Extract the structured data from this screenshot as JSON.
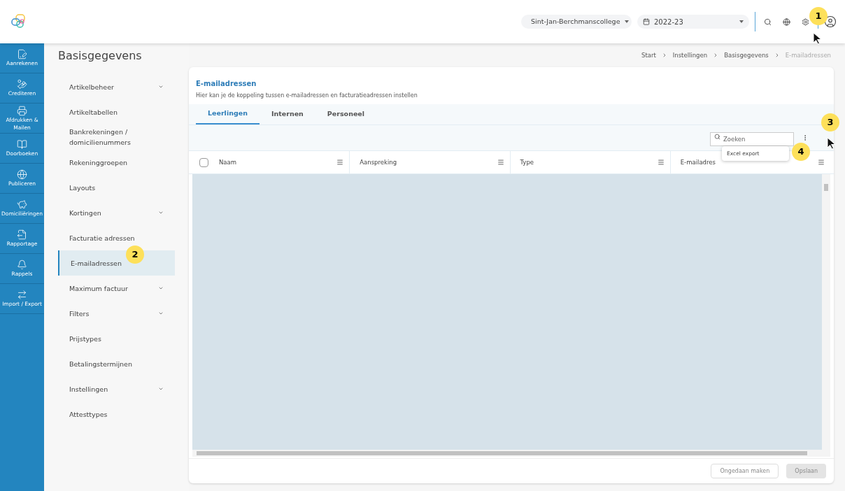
{
  "header": {
    "school": "Sint-Jan-Berchmanscollege",
    "year": "2022-23"
  },
  "rail": [
    {
      "label": "Aanrekenen"
    },
    {
      "label": "Crediteren"
    },
    {
      "label": "Afdrukken & Mailen"
    },
    {
      "label": "Doorboeken"
    },
    {
      "label": "Publiceren"
    },
    {
      "label": "Domiciliëringen"
    },
    {
      "label": "Rapportage"
    },
    {
      "label": "Rappels"
    },
    {
      "label": "Import / Export"
    }
  ],
  "page_title": "Basisgegevens",
  "breadcrumb": [
    "Start",
    "Instellingen",
    "Basisgegevens",
    "E-mailadressen"
  ],
  "menu": [
    {
      "label": "Artikelbeheer",
      "expandable": true,
      "selected": false
    },
    {
      "label": "Artikeltabellen",
      "expandable": false,
      "selected": false
    },
    {
      "label": "Bankrekeningen / domicilienummers",
      "expandable": false,
      "selected": false
    },
    {
      "label": "Rekeninggroepen",
      "expandable": false,
      "selected": false
    },
    {
      "label": "Layouts",
      "expandable": false,
      "selected": false
    },
    {
      "label": "Kortingen",
      "expandable": true,
      "selected": false
    },
    {
      "label": "Facturatie adressen",
      "expandable": false,
      "selected": false
    },
    {
      "label": "E-mailadressen",
      "expandable": false,
      "selected": true
    },
    {
      "label": "Maximum factuur",
      "expandable": true,
      "selected": false
    },
    {
      "label": "Filters",
      "expandable": true,
      "selected": false
    },
    {
      "label": "Prijstypes",
      "expandable": false,
      "selected": false
    },
    {
      "label": "Betalingstermijnen",
      "expandable": false,
      "selected": false
    },
    {
      "label": "Instellingen",
      "expandable": true,
      "selected": false
    },
    {
      "label": "Attesttypes",
      "expandable": false,
      "selected": false
    }
  ],
  "card": {
    "title": "E-mailadressen",
    "description": "Hier kan je de koppeling tussen e-mailadressen en facturatieadressen instellen",
    "tabs": [
      {
        "label": "Leerlingen",
        "selected": true
      },
      {
        "label": "Internen",
        "selected": false
      },
      {
        "label": "Personeel",
        "selected": false
      }
    ],
    "search": {
      "placeholder": "Zoeken"
    },
    "more_menu": [
      "Excel export"
    ],
    "table": {
      "select_all": {
        "checked": false
      },
      "columns": [
        "Naam",
        "Aanspreking",
        "Type",
        "E-mailadres"
      ]
    },
    "buttons": [
      {
        "label": "Ongedaan maken",
        "disabled": true
      },
      {
        "label": "Opslaan",
        "disabled": true
      }
    ]
  },
  "callouts": [
    "1",
    "2",
    "3",
    "4"
  ]
}
